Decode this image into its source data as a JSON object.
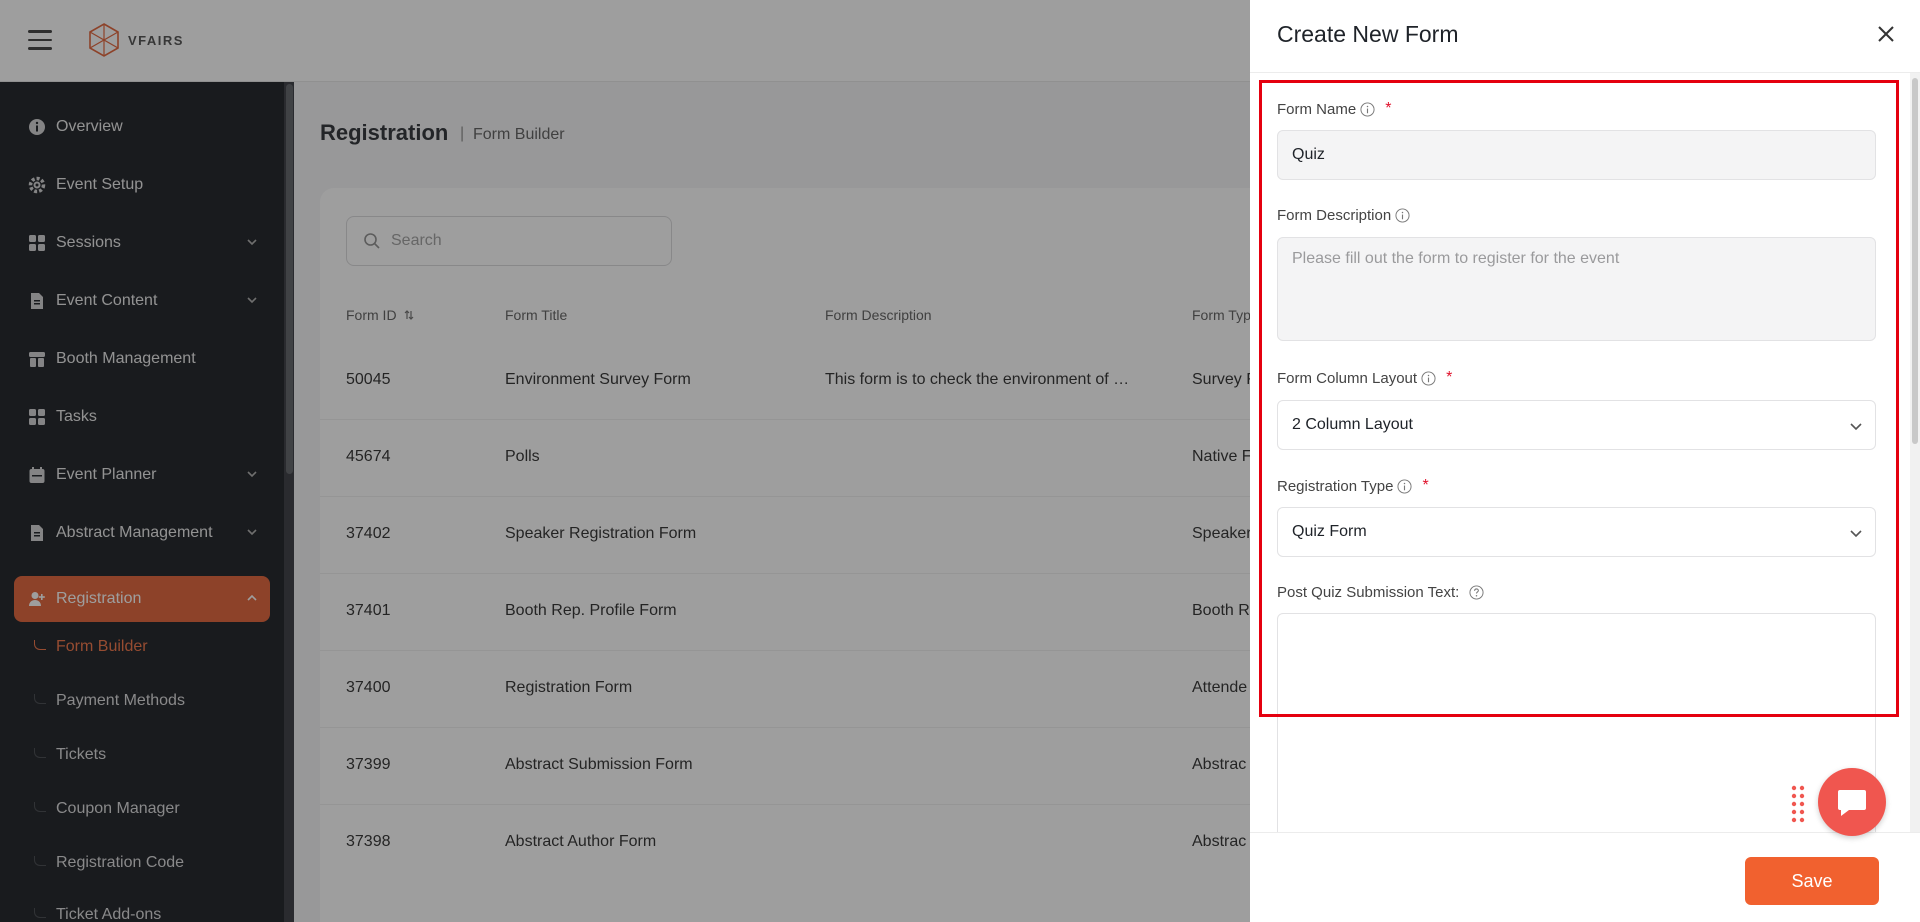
{
  "topbar": {
    "logo_text": "VFAIRS"
  },
  "sidebar": {
    "items": [
      {
        "label": "Overview"
      },
      {
        "label": "Event Setup"
      },
      {
        "label": "Sessions"
      },
      {
        "label": "Event Content"
      },
      {
        "label": "Booth Management"
      },
      {
        "label": "Tasks"
      },
      {
        "label": "Event Planner"
      },
      {
        "label": "Abstract Management"
      },
      {
        "label": "Registration"
      }
    ],
    "sub_items": [
      {
        "label": "Form Builder"
      },
      {
        "label": "Payment Methods"
      },
      {
        "label": "Tickets"
      },
      {
        "label": "Coupon Manager"
      },
      {
        "label": "Registration Code"
      },
      {
        "label": "Ticket Add-ons"
      }
    ]
  },
  "main": {
    "title": "Registration",
    "separator": "|",
    "subtitle": "Form Builder",
    "search_placeholder": "Search",
    "columns": [
      "Form ID",
      "Form Title",
      "Form Description",
      "Form Typ"
    ],
    "rows": [
      {
        "id": "50045",
        "title": "Environment Survey Form",
        "description": "This form is to check the environment of …",
        "type": "Survey F"
      },
      {
        "id": "45674",
        "title": "Polls",
        "description": "",
        "type": "Native F"
      },
      {
        "id": "37402",
        "title": "Speaker Registration Form",
        "description": "",
        "type": "Speaker"
      },
      {
        "id": "37401",
        "title": "Booth Rep. Profile Form",
        "description": "",
        "type": "Booth R"
      },
      {
        "id": "37400",
        "title": "Registration Form",
        "description": "",
        "type": "Attende"
      },
      {
        "id": "37399",
        "title": "Abstract Submission Form",
        "description": "",
        "type": "Abstrac"
      },
      {
        "id": "37398",
        "title": "Abstract Author Form",
        "description": "",
        "type": "Abstrac"
      }
    ]
  },
  "drawer": {
    "title": "Create New Form",
    "form_name_label": "Form Name",
    "form_name_value": "Quiz",
    "form_description_label": "Form Description",
    "form_description_placeholder": "Please fill out the form to register for the event",
    "column_layout_label": "Form Column Layout",
    "column_layout_value": "2 Column Layout",
    "registration_type_label": "Registration Type",
    "registration_type_value": "Quiz Form",
    "post_quiz_label": "Post Quiz Submission Text:",
    "required_mark": "*",
    "save_label": "Save"
  },
  "colors": {
    "accent": "#f1612f",
    "active_nav": "#e0582b",
    "sidebar_bg": "#0e1116",
    "highlight": "#e5000f"
  }
}
